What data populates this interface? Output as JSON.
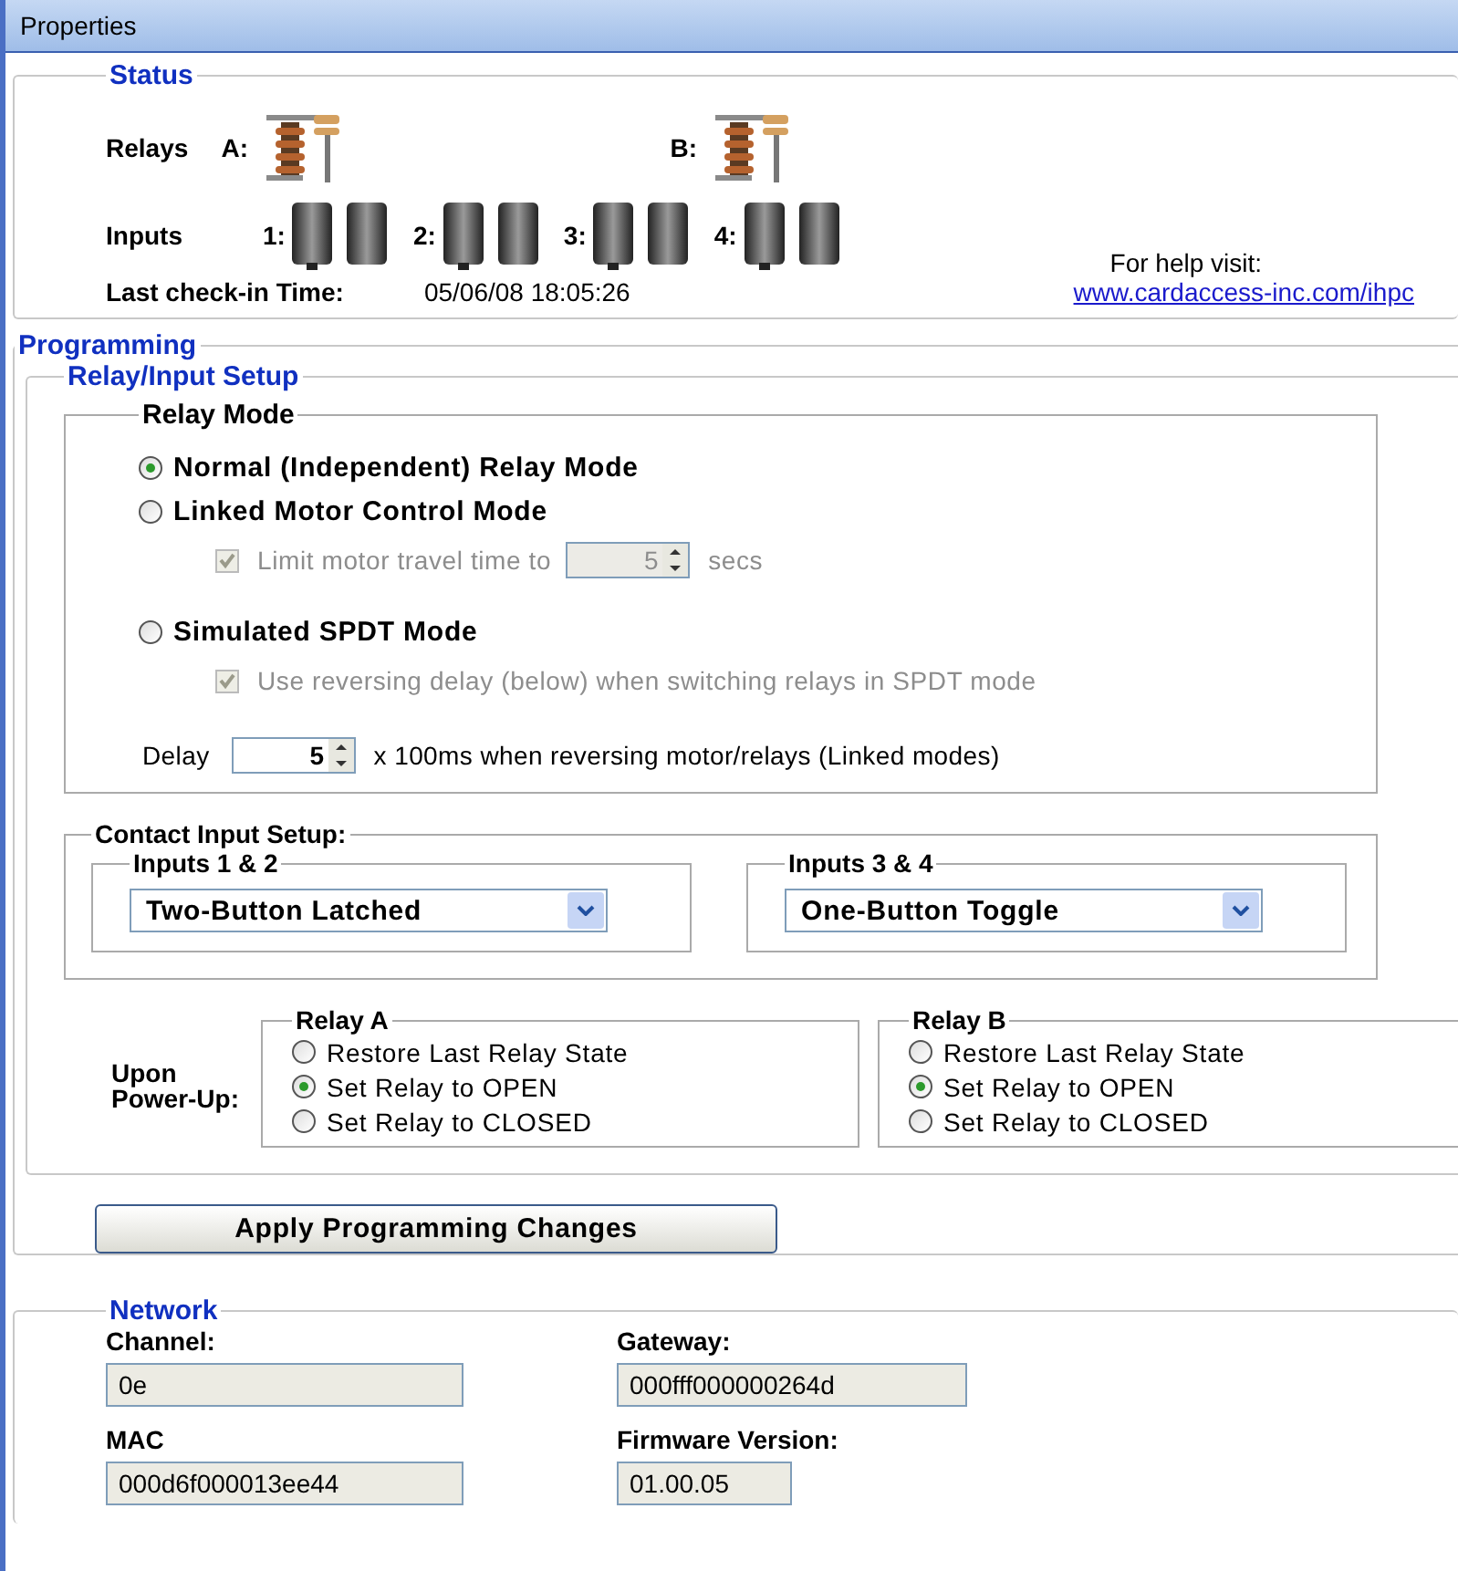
{
  "window": {
    "title": "Properties"
  },
  "status": {
    "title": "Status",
    "relays_label": "Relays",
    "relays": [
      {
        "label": "A:"
      },
      {
        "label": "B:"
      }
    ],
    "inputs_label": "Inputs",
    "inputs": [
      {
        "label": "1:"
      },
      {
        "label": "2:"
      },
      {
        "label": "3:"
      },
      {
        "label": "4:"
      }
    ],
    "checkin_label": "Last check-in Time:",
    "checkin_value": "05/06/08 18:05:26",
    "help_text": "For help visit:",
    "help_link": "www.cardaccess-inc.com/ihpc"
  },
  "programming": {
    "title": "Programming",
    "setup_title": "Relay/Input Setup",
    "relay_mode": {
      "title": "Relay Mode",
      "options": [
        {
          "label": "Normal (Independent) Relay Mode",
          "selected": true
        },
        {
          "label": "Linked Motor Control Mode",
          "selected": false,
          "sub": {
            "label": "Limit motor travel time to",
            "checked": true,
            "disabled": true,
            "value": "5",
            "unit": "secs"
          }
        },
        {
          "label": "Simulated SPDT Mode",
          "selected": false,
          "sub": {
            "label": "Use reversing delay (below) when switching relays in SPDT mode",
            "checked": true,
            "disabled": true
          }
        }
      ],
      "delay": {
        "label": "Delay",
        "value": "5",
        "suffix": "x 100ms when reversing motor/relays (Linked modes)"
      }
    },
    "contact_input": {
      "title": "Contact Input Setup:",
      "groups": [
        {
          "title": "Inputs 1 & 2",
          "value": "Two-Button Latched"
        },
        {
          "title": "Inputs 3 & 4",
          "value": "One-Button Toggle"
        }
      ]
    },
    "power_up": {
      "label": "Upon Power-Up:",
      "relays": [
        {
          "title": "Relay A",
          "options": [
            {
              "label": "Restore Last Relay State",
              "selected": false
            },
            {
              "label": "Set Relay to OPEN",
              "selected": true
            },
            {
              "label": "Set Relay to CLOSED",
              "selected": false
            }
          ]
        },
        {
          "title": "Relay B",
          "options": [
            {
              "label": "Restore Last Relay State",
              "selected": false
            },
            {
              "label": "Set Relay to OPEN",
              "selected": true
            },
            {
              "label": "Set Relay to CLOSED",
              "selected": false
            }
          ]
        }
      ]
    },
    "apply_button": "Apply Programming Changes"
  },
  "network": {
    "title": "Network",
    "fields": [
      {
        "label": "Channel:",
        "value": "0e"
      },
      {
        "label": "Gateway:",
        "value": "000fff000000264d"
      },
      {
        "label": "MAC",
        "value": "000d6f000013ee44"
      },
      {
        "label": "Firmware Version:",
        "value": "01.00.05"
      }
    ]
  }
}
